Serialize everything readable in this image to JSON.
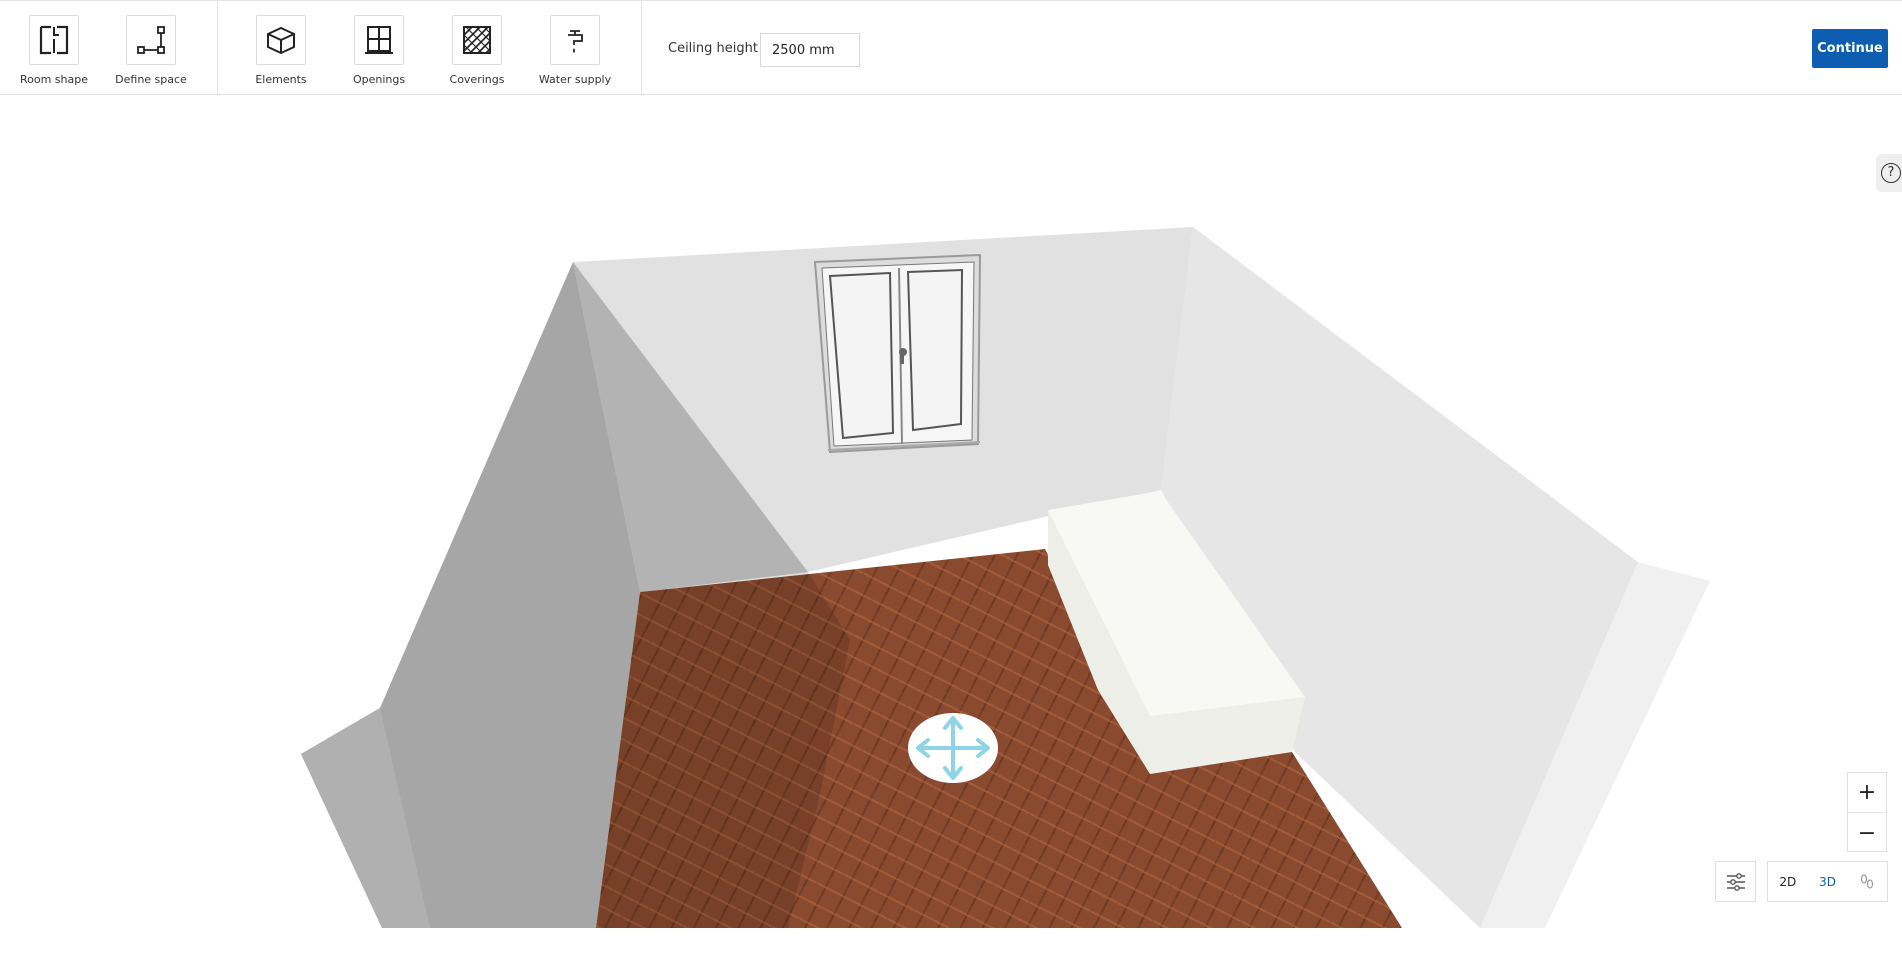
{
  "toolbar": {
    "tools": [
      {
        "label": "Room shape",
        "icon": "room-shape-icon"
      },
      {
        "label": "Define space",
        "icon": "define-space-icon"
      },
      {
        "label": "Elements",
        "icon": "cube-icon"
      },
      {
        "label": "Openings",
        "icon": "window-icon"
      },
      {
        "label": "Coverings",
        "icon": "hatched-tile-icon"
      },
      {
        "label": "Water supply",
        "icon": "faucet-icon"
      }
    ],
    "ceiling_label": "Ceiling height",
    "ceiling_value": "2500 mm",
    "continue_label": "Continue"
  },
  "help": {
    "label": "?"
  },
  "zoom": {
    "in_label": "+",
    "out_label": "−"
  },
  "view_toggle": {
    "settings_icon": "sliders-icon",
    "two_d": "2D",
    "three_d": "3D",
    "walk_icon": "footsteps-icon",
    "active": "3D"
  },
  "colors": {
    "accent": "#0d5eb1",
    "floor": "#8a4a30",
    "wall_light": "#e1e1e1",
    "wall_dark": "#a6a6a6",
    "move_handle": "#8fd3e6"
  }
}
